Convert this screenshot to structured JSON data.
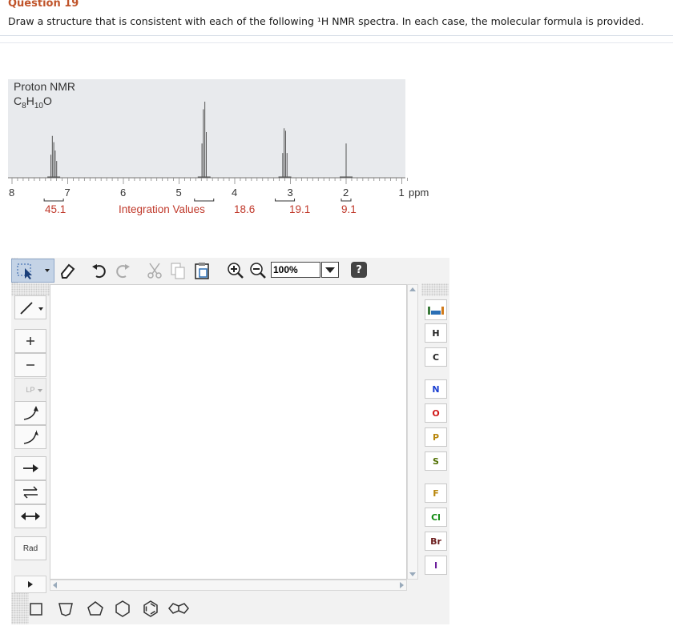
{
  "question": {
    "title": "Question 19",
    "text": "Draw a structure that is consistent with each of the following ¹H NMR spectra. In each case, the molecular formula is provided."
  },
  "spectrum": {
    "label": "Proton NMR",
    "formula_prefix": "C",
    "formula_sub1": "8",
    "formula_mid": "H",
    "formula_sub2": "10",
    "formula_suffix": "O",
    "axis_unit": "ppm",
    "ticks": [
      "8",
      "7",
      "6",
      "5",
      "4",
      "3",
      "2",
      "1"
    ],
    "integration_caption": "Integration Values",
    "integrations": [
      "45.1",
      "18.6",
      "19.1",
      "9.1"
    ]
  },
  "chart_data": {
    "type": "line",
    "title": "",
    "xlabel": "ppm",
    "xlim": [
      8,
      1
    ],
    "x_ticks": [
      8,
      7,
      6,
      5,
      4,
      3,
      2,
      1
    ],
    "peaks": [
      {
        "ppm": 7.25,
        "integration": 45.1
      },
      {
        "ppm": 4.55,
        "integration": 18.6
      },
      {
        "ppm": 3.1,
        "integration": 19.1
      },
      {
        "ppm": 2.0,
        "integration": 9.1
      }
    ]
  },
  "editor": {
    "zoom_value": "100%",
    "help_label": "?",
    "colors": {
      "accent": "#2a6fb5",
      "toolbar_bg": "#f2f2f2"
    },
    "atoms": [
      {
        "label": "H",
        "color": "#222222"
      },
      {
        "label": "C",
        "color": "#222222"
      },
      {
        "label": "N",
        "color": "#1a3fd1"
      },
      {
        "label": "O",
        "color": "#d11a1a"
      },
      {
        "label": "P",
        "color": "#b8860b"
      },
      {
        "label": "S",
        "color": "#4f6f00"
      },
      {
        "label": "F",
        "color": "#b8860b"
      },
      {
        "label": "Cl",
        "color": "#0f8a0f"
      },
      {
        "label": "Br",
        "color": "#6b1d1d"
      },
      {
        "label": "I",
        "color": "#6a1b9a"
      }
    ],
    "left_tools": {
      "lone_pair": "LP",
      "radical": "Rad"
    }
  }
}
